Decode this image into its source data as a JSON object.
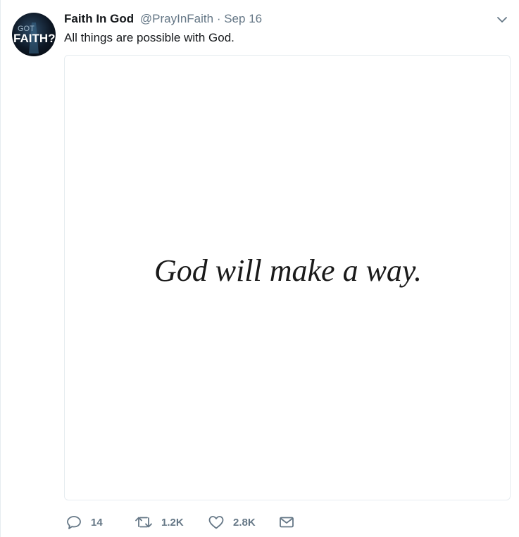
{
  "tweet": {
    "display_name": "Faith In God",
    "handle": "@PrayInFaith",
    "separator": "·",
    "date": "Sep 16",
    "text": "All things are possible with God.",
    "avatar": {
      "text_top": "GOT",
      "text_main": "FAITH?"
    },
    "image_text": "God will make a way.",
    "icons": {
      "menu": "chevron-down-icon",
      "reply": "reply-icon",
      "retweet": "retweet-icon",
      "like": "heart-icon",
      "dm": "envelope-icon"
    },
    "stats": {
      "replies": "14",
      "retweets": "1.2K",
      "likes": "2.8K"
    }
  },
  "colors": {
    "text": "#14171a",
    "secondary": "#657786",
    "border": "#e6ecf0"
  }
}
